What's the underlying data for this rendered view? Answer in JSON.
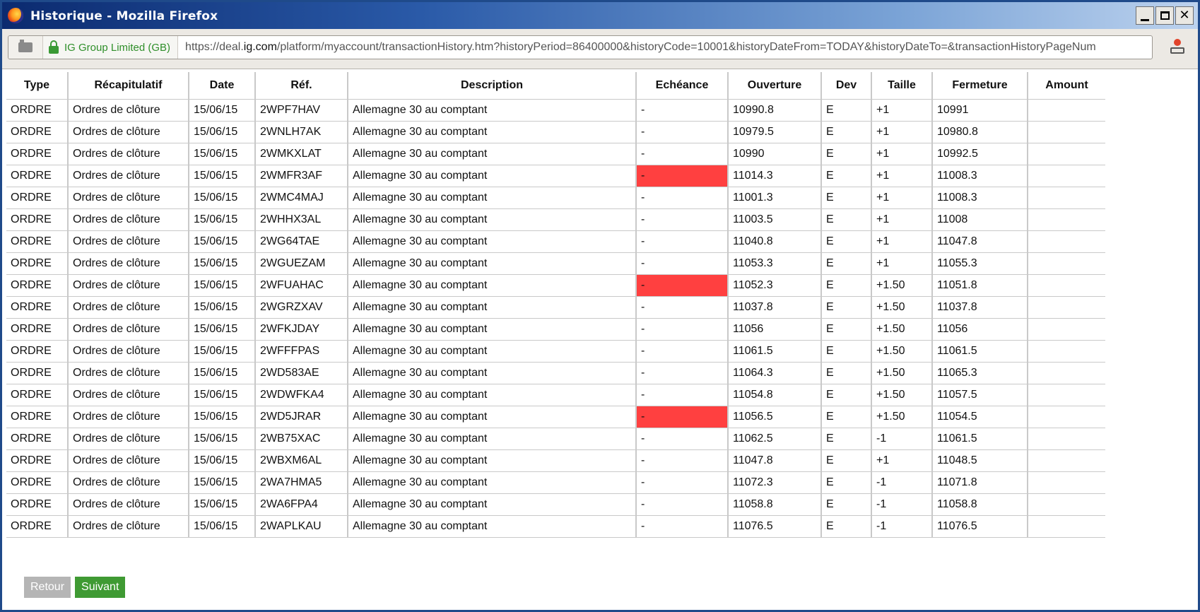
{
  "window": {
    "title": "Historique - Mozilla Firefox",
    "controls": {
      "minimize": "_",
      "maximize": "□",
      "close": "✕"
    }
  },
  "address_bar": {
    "site_identity": "IG Group Limited (GB)",
    "url_prefix": "https://deal.",
    "url_domain": "ig.com",
    "url_rest": "/platform/myaccount/transactionHistory.htm?historyPeriod=86400000&historyCode=10001&historyDateFrom=TODAY&historyDateTo=&transactionHistoryPageNum"
  },
  "table": {
    "headers": [
      "Type",
      "Récapitulatif",
      "Date",
      "Réf.",
      "Description",
      "Echéance",
      "Ouverture",
      "Dev",
      "Taille",
      "Fermeture",
      "Amount"
    ],
    "rows": [
      {
        "type": "ORDRE",
        "recap": "Ordres de clôture",
        "date": "15/06/15",
        "ref": "2WPF7HAV",
        "desc": "Allemagne 30 au comptant",
        "echeance": "-",
        "ouverture": "10990.8",
        "dev": "E",
        "taille": "+1",
        "fermeture": "10991",
        "amount": "",
        "highlight": false
      },
      {
        "type": "ORDRE",
        "recap": "Ordres de clôture",
        "date": "15/06/15",
        "ref": "2WNLH7AK",
        "desc": "Allemagne 30 au comptant",
        "echeance": "-",
        "ouverture": "10979.5",
        "dev": "E",
        "taille": "+1",
        "fermeture": "10980.8",
        "amount": "",
        "highlight": false
      },
      {
        "type": "ORDRE",
        "recap": "Ordres de clôture",
        "date": "15/06/15",
        "ref": "2WMKXLAT",
        "desc": "Allemagne 30 au comptant",
        "echeance": "-",
        "ouverture": "10990",
        "dev": "E",
        "taille": "+1",
        "fermeture": "10992.5",
        "amount": "",
        "highlight": false
      },
      {
        "type": "ORDRE",
        "recap": "Ordres de clôture",
        "date": "15/06/15",
        "ref": "2WMFR3AF",
        "desc": "Allemagne 30 au comptant",
        "echeance": "-",
        "ouverture": "11014.3",
        "dev": "E",
        "taille": "+1",
        "fermeture": "11008.3",
        "amount": "",
        "highlight": true
      },
      {
        "type": "ORDRE",
        "recap": "Ordres de clôture",
        "date": "15/06/15",
        "ref": "2WMC4MAJ",
        "desc": "Allemagne 30 au comptant",
        "echeance": "-",
        "ouverture": "11001.3",
        "dev": "E",
        "taille": "+1",
        "fermeture": "11008.3",
        "amount": "",
        "highlight": false
      },
      {
        "type": "ORDRE",
        "recap": "Ordres de clôture",
        "date": "15/06/15",
        "ref": "2WHHX3AL",
        "desc": "Allemagne 30 au comptant",
        "echeance": "-",
        "ouverture": "11003.5",
        "dev": "E",
        "taille": "+1",
        "fermeture": "11008",
        "amount": "",
        "highlight": false
      },
      {
        "type": "ORDRE",
        "recap": "Ordres de clôture",
        "date": "15/06/15",
        "ref": "2WG64TAE",
        "desc": "Allemagne 30 au comptant",
        "echeance": "-",
        "ouverture": "11040.8",
        "dev": "E",
        "taille": "+1",
        "fermeture": "11047.8",
        "amount": "",
        "highlight": false
      },
      {
        "type": "ORDRE",
        "recap": "Ordres de clôture",
        "date": "15/06/15",
        "ref": "2WGUEZAM",
        "desc": "Allemagne 30 au comptant",
        "echeance": "-",
        "ouverture": "11053.3",
        "dev": "E",
        "taille": "+1",
        "fermeture": "11055.3",
        "amount": "",
        "highlight": false
      },
      {
        "type": "ORDRE",
        "recap": "Ordres de clôture",
        "date": "15/06/15",
        "ref": "2WFUAHAC",
        "desc": "Allemagne 30 au comptant",
        "echeance": "-",
        "ouverture": "11052.3",
        "dev": "E",
        "taille": "+1.50",
        "fermeture": "11051.8",
        "amount": "",
        "highlight": true
      },
      {
        "type": "ORDRE",
        "recap": "Ordres de clôture",
        "date": "15/06/15",
        "ref": "2WGRZXAV",
        "desc": "Allemagne 30 au comptant",
        "echeance": "-",
        "ouverture": "11037.8",
        "dev": "E",
        "taille": "+1.50",
        "fermeture": "11037.8",
        "amount": "",
        "highlight": false
      },
      {
        "type": "ORDRE",
        "recap": "Ordres de clôture",
        "date": "15/06/15",
        "ref": "2WFKJDAY",
        "desc": "Allemagne 30 au comptant",
        "echeance": "-",
        "ouverture": "11056",
        "dev": "E",
        "taille": "+1.50",
        "fermeture": "11056",
        "amount": "",
        "highlight": false
      },
      {
        "type": "ORDRE",
        "recap": "Ordres de clôture",
        "date": "15/06/15",
        "ref": "2WFFFPAS",
        "desc": "Allemagne 30 au comptant",
        "echeance": "-",
        "ouverture": "11061.5",
        "dev": "E",
        "taille": "+1.50",
        "fermeture": "11061.5",
        "amount": "",
        "highlight": false
      },
      {
        "type": "ORDRE",
        "recap": "Ordres de clôture",
        "date": "15/06/15",
        "ref": "2WD583AE",
        "desc": "Allemagne 30 au comptant",
        "echeance": "-",
        "ouverture": "11064.3",
        "dev": "E",
        "taille": "+1.50",
        "fermeture": "11065.3",
        "amount": "",
        "highlight": false
      },
      {
        "type": "ORDRE",
        "recap": "Ordres de clôture",
        "date": "15/06/15",
        "ref": "2WDWFKA4",
        "desc": "Allemagne 30 au comptant",
        "echeance": "-",
        "ouverture": "11054.8",
        "dev": "E",
        "taille": "+1.50",
        "fermeture": "11057.5",
        "amount": "",
        "highlight": false
      },
      {
        "type": "ORDRE",
        "recap": "Ordres de clôture",
        "date": "15/06/15",
        "ref": "2WD5JRAR",
        "desc": "Allemagne 30 au comptant",
        "echeance": "-",
        "ouverture": "11056.5",
        "dev": "E",
        "taille": "+1.50",
        "fermeture": "11054.5",
        "amount": "",
        "highlight": true
      },
      {
        "type": "ORDRE",
        "recap": "Ordres de clôture",
        "date": "15/06/15",
        "ref": "2WB75XAC",
        "desc": "Allemagne 30 au comptant",
        "echeance": "-",
        "ouverture": "11062.5",
        "dev": "E",
        "taille": "-1",
        "fermeture": "11061.5",
        "amount": "",
        "highlight": false
      },
      {
        "type": "ORDRE",
        "recap": "Ordres de clôture",
        "date": "15/06/15",
        "ref": "2WBXM6AL",
        "desc": "Allemagne 30 au comptant",
        "echeance": "-",
        "ouverture": "11047.8",
        "dev": "E",
        "taille": "+1",
        "fermeture": "11048.5",
        "amount": "",
        "highlight": false
      },
      {
        "type": "ORDRE",
        "recap": "Ordres de clôture",
        "date": "15/06/15",
        "ref": "2WA7HMA5",
        "desc": "Allemagne 30 au comptant",
        "echeance": "-",
        "ouverture": "11072.3",
        "dev": "E",
        "taille": "-1",
        "fermeture": "11071.8",
        "amount": "",
        "highlight": false
      },
      {
        "type": "ORDRE",
        "recap": "Ordres de clôture",
        "date": "15/06/15",
        "ref": "2WA6FPA4",
        "desc": "Allemagne 30 au comptant",
        "echeance": "-",
        "ouverture": "11058.8",
        "dev": "E",
        "taille": "-1",
        "fermeture": "11058.8",
        "amount": "",
        "highlight": false
      },
      {
        "type": "ORDRE",
        "recap": "Ordres de clôture",
        "date": "15/06/15",
        "ref": "2WAPLKAU",
        "desc": "Allemagne 30 au comptant",
        "echeance": "-",
        "ouverture": "11076.5",
        "dev": "E",
        "taille": "-1",
        "fermeture": "11076.5",
        "amount": "",
        "highlight": false
      }
    ]
  },
  "pagination": {
    "prev_label": "Retour",
    "next_label": "Suivant"
  },
  "colors": {
    "highlight": "#ff4040",
    "next_button": "#3f9a33",
    "prev_button": "#b5b5b5",
    "secure_text": "#2f8f2a"
  }
}
